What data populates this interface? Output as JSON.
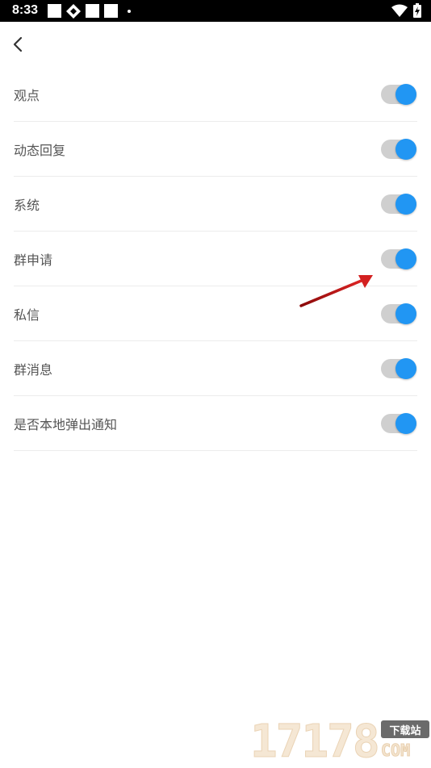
{
  "status_bar": {
    "time": "8:33",
    "icons": [
      "notification-square-icon",
      "sync-icon",
      "notification-square-icon",
      "notification-square-icon",
      "dot-icon",
      "wifi-icon",
      "battery-charging-icon"
    ]
  },
  "app_bar": {
    "back_icon": "chevron-left-icon"
  },
  "settings": {
    "items": [
      {
        "label": "观点",
        "enabled": true
      },
      {
        "label": "动态回复",
        "enabled": true
      },
      {
        "label": "系统",
        "enabled": true
      },
      {
        "label": "群申请",
        "enabled": true
      },
      {
        "label": "私信",
        "enabled": true
      },
      {
        "label": "群消息",
        "enabled": true
      },
      {
        "label": "是否本地弹出通知",
        "enabled": true
      }
    ]
  },
  "colors": {
    "toggle_on": "#2196f3",
    "toggle_track": "#cfcfcf",
    "annotation_arrow": "#d32020"
  },
  "watermark": {
    "digits": "17178",
    "badge": "下载站",
    "suffix": "COM"
  }
}
